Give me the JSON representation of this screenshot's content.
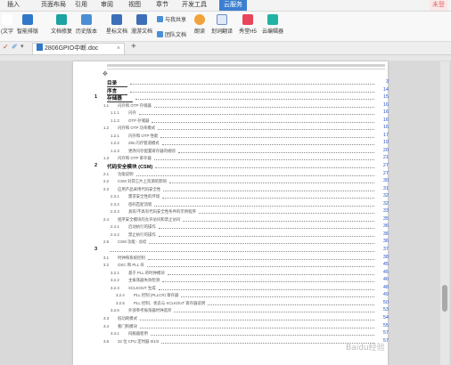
{
  "menubar": {
    "tabs": [
      "插入",
      "页面布局",
      "引用",
      "审阅",
      "视图",
      "章节",
      "开发工具",
      "云服务"
    ],
    "active_tab": "云服务",
    "right_label": "未登"
  },
  "ribbon": {
    "items": [
      {
        "label": "(文字",
        "icon": "text-icon"
      },
      {
        "label": "智能排版",
        "icon": "smart-layout-icon"
      },
      {
        "label": "文档修复",
        "icon": "doc-repair-icon"
      },
      {
        "label": "历史版本",
        "icon": "history-icon"
      },
      {
        "label": "星标文档",
        "icon": "star-doc-icon"
      },
      {
        "label": "漫游文档",
        "icon": "roaming-doc-icon"
      },
      {
        "label": "团队文档",
        "icon": "team-doc-icon"
      },
      {
        "label": "与我共享",
        "icon": "shared-icon"
      },
      {
        "label": "朗读",
        "icon": "read-aloud-icon"
      },
      {
        "label": "划词翻译",
        "icon": "translate-icon"
      },
      {
        "label": "秀堂H5",
        "icon": "h5-icon"
      },
      {
        "label": "云编辑器",
        "icon": "cloud-editor-icon"
      }
    ]
  },
  "tabbar": {
    "doc_name": "2806GPIO中断.doc",
    "close": "×",
    "add": "+"
  },
  "toc": [
    {
      "num": "",
      "title": "目录",
      "page": "3",
      "level": 0
    },
    {
      "num": "",
      "title": "序言",
      "page": "14",
      "level": 0
    },
    {
      "num": "1",
      "title": "存储器",
      "page": "15",
      "level": 0
    },
    {
      "num": "1.1",
      "title": "闪存和 OTP 存储器",
      "page": "16",
      "level": 1
    },
    {
      "num": "1.1.1",
      "title": "闪存",
      "page": "16",
      "level": 2
    },
    {
      "num": "1.1.2",
      "title": "OTP 存储器",
      "page": "16",
      "level": 2
    },
    {
      "num": "1.2",
      "title": "闪存和 OTP 功率模式",
      "page": "16",
      "level": 1
    },
    {
      "num": "1.2.1",
      "title": "闪存和 OTP 性能",
      "page": "17",
      "level": 2
    },
    {
      "num": "1.2.2",
      "title": "28x 闪存管道模式",
      "page": "19",
      "level": 2
    },
    {
      "num": "1.2.3",
      "title": "更改闪存配置寄存器的规则",
      "page": "20",
      "level": 2
    },
    {
      "num": "1.3",
      "title": "闪存和 OTP 寄存器",
      "page": "21",
      "level": 1
    },
    {
      "num": "2",
      "title": "代码安全模块 (CSM)",
      "page": "27",
      "level": 0
    },
    {
      "num": "2.1",
      "title": "功能说明",
      "page": "27",
      "level": 1
    },
    {
      "num": "2.2",
      "title": "CSM 对其它片上资源的影响",
      "page": "30",
      "level": 1
    },
    {
      "num": "2.3",
      "title": "应用产品采用代码安全性",
      "page": "31",
      "level": 1
    },
    {
      "num": "2.3.1",
      "title": "需求安全性的环境",
      "page": "32",
      "level": 2
    },
    {
      "num": "2.3.2",
      "title": "密码匹配流程",
      "page": "32",
      "level": 2
    },
    {
      "num": "2.3.3",
      "title": "具有/不具有代码安全性条件的示例程序",
      "page": "33",
      "level": 2
    },
    {
      "num": "2.4",
      "title": "程序安全模块的允许访问和禁止访问",
      "page": "35",
      "level": 1
    },
    {
      "num": "2.4.1",
      "title": "启动执行的操作",
      "page": "36",
      "level": 2
    },
    {
      "num": "2.4.2",
      "title": "禁止执行的操作",
      "page": "36",
      "level": 2
    },
    {
      "num": "2.5",
      "title": "CSM 功能 - 总结",
      "page": "36",
      "level": 1
    },
    {
      "num": "3",
      "title": "",
      "page": "37",
      "level": 0
    },
    {
      "num": "3.1",
      "title": "时钟和系统控制",
      "page": "38",
      "level": 1
    },
    {
      "num": "3.2",
      "title": "OSC 和 PLL 块",
      "page": "45",
      "level": 1
    },
    {
      "num": "3.2.1",
      "title": "基于 PLL 的时钟模块",
      "page": "45",
      "level": 2
    },
    {
      "num": "3.2.2",
      "title": "主振荡器失效检测",
      "page": "46",
      "level": 2
    },
    {
      "num": "3.2.3",
      "title": "XCLKOUT 生成",
      "page": "48",
      "level": 2
    },
    {
      "num": "3.2.4",
      "title": "PLL 控制 (PLLCR) 寄存器",
      "page": "49",
      "level": 3
    },
    {
      "num": "3.2.5",
      "title": "PLL 控制、状态与 XCLKOUT 寄存器说明",
      "page": "50",
      "level": 3
    },
    {
      "num": "3.2.6",
      "title": "外部参考振荡器时钟选项",
      "page": "53",
      "level": 2
    },
    {
      "num": "3.3",
      "title": "低功耗模式",
      "page": "54",
      "level": 1
    },
    {
      "num": "3.4",
      "title": "看门狗模块",
      "page": "55",
      "level": 1
    },
    {
      "num": "3.4.1",
      "title": "伺服器使用",
      "page": "57",
      "level": 2
    },
    {
      "num": "3.5",
      "title": "32 位 CPU 定时器 0/1/2",
      "page": "57",
      "level": 1
    }
  ],
  "watermark": "Baidu经验"
}
